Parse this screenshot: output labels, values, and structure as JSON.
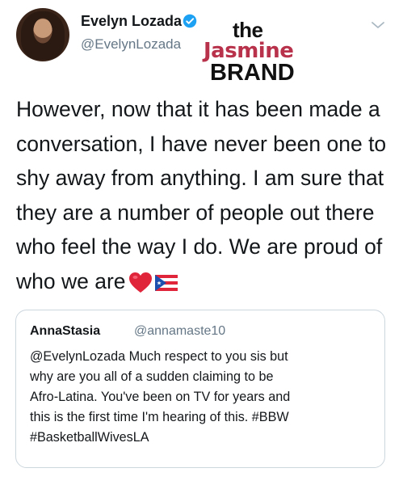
{
  "tweet": {
    "author_name": "Evelyn Lozada",
    "author_handle": "@EvelynLozada",
    "verified": true,
    "body_lines": [
      "However, now that it has been made a",
      "conversation, I have never been one to",
      "shy away from anything. I am sure that",
      "they are a number of people out there",
      "who feel the way I do.  We are proud of",
      "who we are"
    ],
    "emojis": [
      "red-heart",
      "puerto-rico-flag"
    ]
  },
  "watermark": {
    "line1": "the",
    "line2": "Jasmine",
    "line3": "BRAND"
  },
  "quoted_tweet": {
    "author_name": "AnnaStasia",
    "author_handle": "@annamaste10",
    "lines": [
      "@EvelynLozada Much respect to you sis but",
      "why are you all of a sudden claiming to be",
      "Afro-Latina. You've been on TV for years and",
      "this is the first time I'm hearing of this. #BBW",
      "#BasketballWivesLA"
    ]
  },
  "colors": {
    "text": "#14171a",
    "secondary_text": "#657786",
    "verified_blue": "#1da1f2",
    "border": "#ccd6dd",
    "watermark_red": "#b8324b"
  }
}
